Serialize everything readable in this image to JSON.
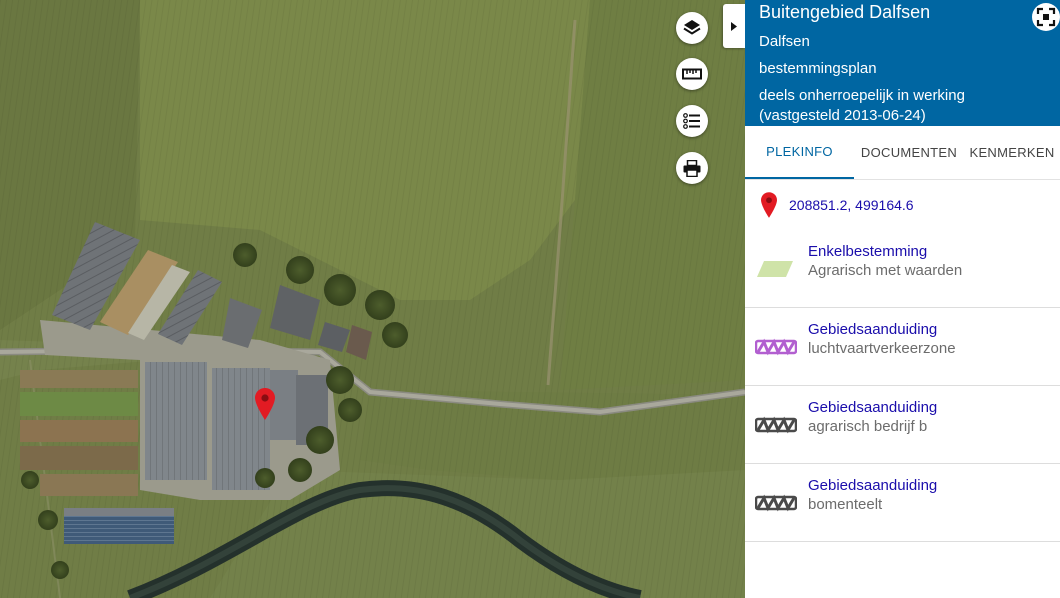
{
  "map": {
    "controls": [
      {
        "name": "layers",
        "icon": "layers-icon"
      },
      {
        "name": "measure",
        "icon": "ruler-icon"
      },
      {
        "name": "legend",
        "icon": "list-icon"
      },
      {
        "name": "print",
        "icon": "printer-icon"
      }
    ],
    "collapse_icon": "caret-right-icon",
    "marker_icon": "map-pin-icon",
    "marker_color": "#e21b23"
  },
  "panel": {
    "title": "Buitengebied Dalfsen",
    "place": "Dalfsen",
    "plan_type": "bestemmingsplan",
    "status": "deels onherroepelijk in werking (vastgesteld 2013-06-24)",
    "header_color": "#0066a2",
    "expand_icon": "fullscreen-icon",
    "tabs": [
      {
        "label": "PLEKINFO",
        "active": true
      },
      {
        "label": "DOCUMENTEN",
        "active": false
      },
      {
        "label": "KENMERKEN",
        "active": false
      }
    ],
    "coordinates": "208851.2, 499164.6",
    "items": [
      {
        "link": "Enkelbestemming",
        "value": "Agrarisch met waarden",
        "symbol_color": "#cfe3a8"
      },
      {
        "link": "Gebiedsaanduiding",
        "value": "luchtvaartverkeerzone",
        "symbol_color": "#b25fd0"
      },
      {
        "link": "Gebiedsaanduiding",
        "value": "agrarisch bedrijf b",
        "symbol_color": "#4a4a4a"
      },
      {
        "link": "Gebiedsaanduiding",
        "value": "bomenteelt",
        "symbol_color": "#4a4a4a"
      }
    ]
  }
}
